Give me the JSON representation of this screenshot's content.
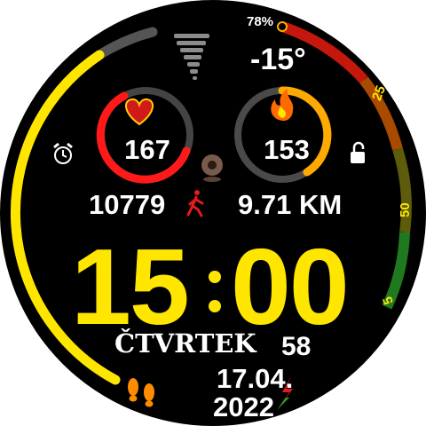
{
  "watchface": {
    "battery": "78%",
    "battery_level": 0.78,
    "temperature": "-15°",
    "heart_rate": "167",
    "calories": "153",
    "steps": "10779",
    "distance": "9.71 KM",
    "time_hours": "15",
    "time_minutes": "00",
    "seconds": "58",
    "day_name": "ČTVRTEK",
    "date": "17.04.",
    "year": "2022",
    "scale_labels": [
      "25",
      "50",
      "5"
    ]
  },
  "colors": {
    "background": "#000000",
    "accent_yellow": "#ffe600",
    "heart_ring": "#ff1a1a",
    "calorie_ring": "#ffaa00",
    "track_gray": "#5a5a5a",
    "scale_red": "#cc1a00",
    "scale_green": "#1e8a1e"
  },
  "icons": [
    "weather-tornado-icon",
    "heart-icon",
    "flame-icon",
    "alarm-clock-icon",
    "lock-icon",
    "center-pin-icon",
    "walking-person-icon",
    "footprints-icon",
    "charging-bolt-icon"
  ]
}
